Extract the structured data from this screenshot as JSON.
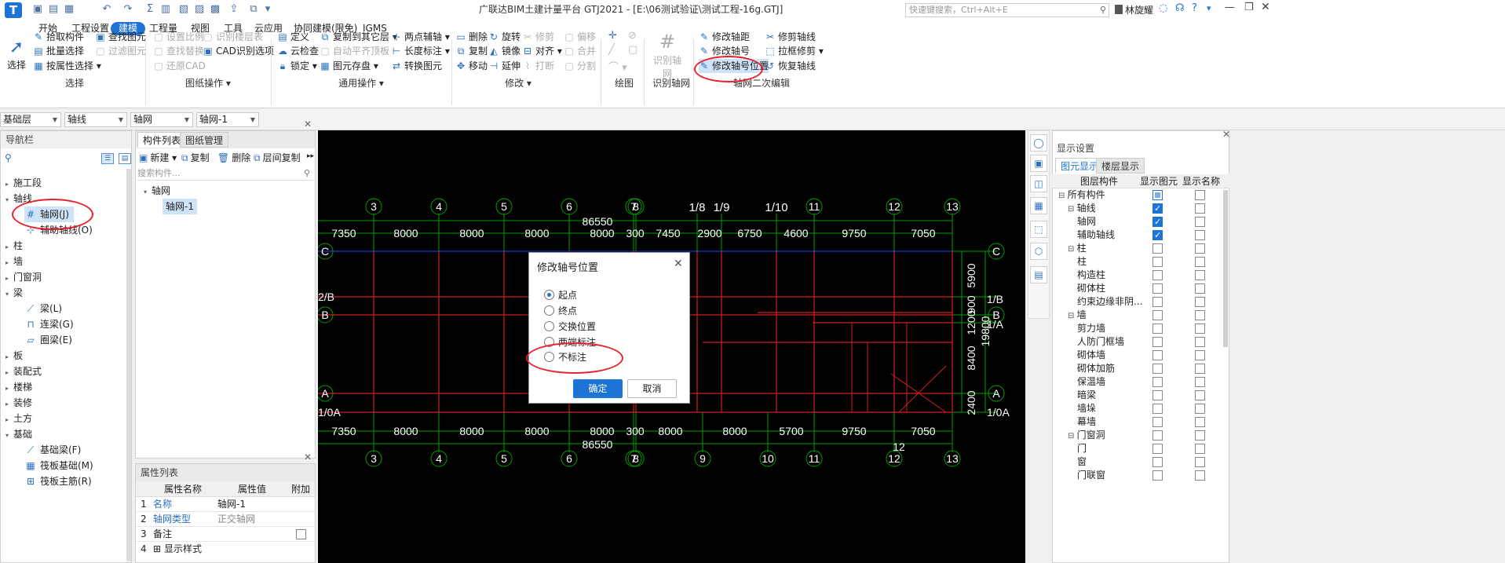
{
  "titlebar": {
    "title": "广联达BIM土建计量平台 GTJ2021 - [E:\\06测试验证\\测试工程-16g.GTJ]",
    "search_placeholder": "快速键搜索，Ctrl+Alt+E",
    "user": "林旋耀"
  },
  "menu": [
    "开始",
    "工程设置",
    "建模",
    "工程量",
    "视图",
    "工具",
    "云应用",
    "协同建模(限免)",
    "IGMS"
  ],
  "ribbon": {
    "select": {
      "big": "选择",
      "items": [
        "拾取构件",
        "批量选择",
        "按属性选择"
      ],
      "items2": [
        "查找图元",
        "过滤图元"
      ],
      "group": "选择"
    },
    "drawing": {
      "items": [
        "设置比例",
        "查找替换",
        "还原CAD"
      ],
      "items2": [
        "识别楼层表",
        "CAD识别选项"
      ],
      "group": "图纸操作"
    },
    "common": {
      "c1": [
        "定义",
        "云检查",
        "锁定"
      ],
      "c2": [
        "复制到其它层",
        "自动平齐顶板",
        "图元存盘"
      ],
      "c3": [
        "两点辅轴",
        "长度标注",
        "转换图元"
      ],
      "group": "通用操作"
    },
    "modify": {
      "c1": [
        "删除",
        "复制",
        "移动"
      ],
      "c2": [
        "旋转",
        "镜像",
        "延伸"
      ],
      "c3": [
        "修剪",
        "对齐",
        "打断"
      ],
      "c4": [
        "偏移",
        "合并",
        "分割"
      ],
      "group": "修改"
    },
    "draw": {
      "group": "绘图"
    },
    "recog": {
      "big": "识别轴网",
      "group": "识别轴网"
    },
    "axisedit": {
      "c1": [
        "修改轴距",
        "修改轴号",
        "修改轴号位置"
      ],
      "c2": [
        "修剪轴线",
        "拉框修剪",
        "恢复轴线"
      ],
      "group": "轴网二次编辑"
    }
  },
  "selectors": [
    "基础层",
    "轴线",
    "轴网",
    "轴网-1"
  ],
  "nav": {
    "title": "导航栏",
    "items": [
      "施工段",
      "轴线",
      "轴网(J)",
      "辅助轴线(O)",
      "柱",
      "墙",
      "门窗洞",
      "梁",
      "梁(L)",
      "连梁(G)",
      "圈梁(E)",
      "板",
      "装配式",
      "楼梯",
      "装修",
      "土方",
      "基础",
      "基础梁(F)",
      "筏板基础(M)",
      "筏板主筋(R)"
    ]
  },
  "comp": {
    "tabs": [
      "构件列表",
      "图纸管理"
    ],
    "toolbar": [
      "新建",
      "复制",
      "删除",
      "层间复制"
    ],
    "search_placeholder": "搜索构件...",
    "tree": [
      "轴网",
      "轴网-1"
    ]
  },
  "props": {
    "title": "属性列表",
    "headers": [
      "属性名称",
      "属性值",
      "附加"
    ],
    "rows": [
      [
        "1",
        "名称",
        "轴网-1"
      ],
      [
        "2",
        "轴网类型",
        "正交轴网"
      ],
      [
        "3",
        "备注",
        ""
      ],
      [
        "4",
        "显示样式",
        ""
      ]
    ]
  },
  "canvas": {
    "top_nums": [
      "3",
      "4",
      "5",
      "6",
      "7",
      "8",
      "1/8",
      "1/9",
      "1/10",
      "11",
      "12",
      "13"
    ],
    "bottom_nums": [
      "3",
      "4",
      "5",
      "6",
      "7",
      "8",
      "9",
      "10",
      "11",
      "12",
      "13"
    ],
    "top_total": "86550",
    "bottom_total": "86550",
    "top_dims": [
      "7350",
      "8000",
      "8000",
      "8000",
      "8000",
      "300",
      "7450",
      "2900",
      "6750",
      "4600",
      "9750",
      "7050"
    ],
    "bottom_dims": [
      "7350",
      "8000",
      "8000",
      "8000",
      "8000",
      "300",
      "8000",
      "8000",
      "5700",
      "9750",
      "7050"
    ],
    "left_labels": [
      "C",
      "2/B",
      "B",
      "A",
      "1/0A"
    ],
    "right_labels": [
      "C",
      "1/B",
      "B",
      "1/A",
      "A",
      "1/0A"
    ],
    "right_dims": [
      "5900",
      "900",
      "1200",
      "8400",
      "2400"
    ],
    "right_total": "19800",
    "dim12": "12"
  },
  "dialog": {
    "title": "修改轴号位置",
    "options": [
      "起点",
      "终点",
      "交换位置",
      "两端标注",
      "不标注"
    ],
    "selected": 0,
    "ok": "确定",
    "cancel": "取消"
  },
  "display": {
    "title": "显示设置",
    "tabs": [
      "图元显示",
      "楼层显示"
    ],
    "headers": [
      "图层构件",
      "显示图元",
      "显示名称"
    ],
    "rows": [
      [
        "所有构件",
        0,
        "part",
        false
      ],
      [
        "轴线",
        1,
        true,
        false
      ],
      [
        "轴网",
        2,
        true,
        false
      ],
      [
        "辅助轴线",
        2,
        true,
        false
      ],
      [
        "柱",
        1,
        false,
        false
      ],
      [
        "柱",
        2,
        false,
        false
      ],
      [
        "构造柱",
        2,
        false,
        false
      ],
      [
        "砌体柱",
        2,
        false,
        false
      ],
      [
        "约束边缘非阴...",
        2,
        false,
        false
      ],
      [
        "墙",
        1,
        false,
        false
      ],
      [
        "剪力墙",
        2,
        false,
        false
      ],
      [
        "人防门框墙",
        2,
        false,
        false
      ],
      [
        "砌体墙",
        2,
        false,
        false
      ],
      [
        "砌体加筋",
        2,
        false,
        false
      ],
      [
        "保温墙",
        2,
        false,
        false
      ],
      [
        "暗梁",
        2,
        false,
        false
      ],
      [
        "墙垛",
        2,
        false,
        false
      ],
      [
        "幕墙",
        2,
        false,
        false
      ],
      [
        "门窗洞",
        1,
        false,
        false
      ],
      [
        "门",
        2,
        false,
        false
      ],
      [
        "窗",
        2,
        false,
        false
      ],
      [
        "门联窗",
        2,
        false,
        false
      ]
    ]
  },
  "colors": {
    "accent": "#1e73d6",
    "axis_green": "#00a000",
    "axis_red": "#d21e1e",
    "highlight": "#e8202a"
  }
}
